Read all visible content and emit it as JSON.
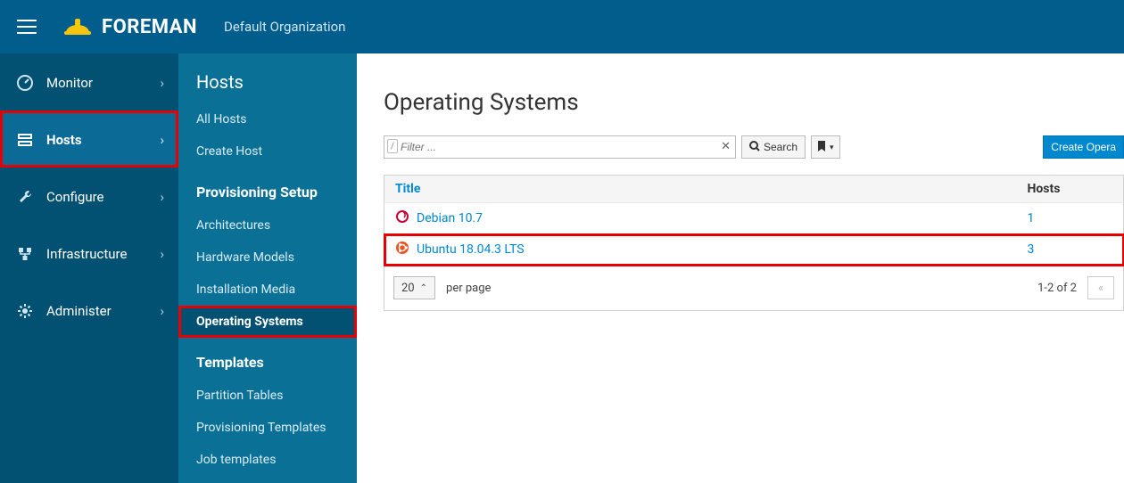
{
  "header": {
    "brand": "FOREMAN",
    "organization": "Default Organization"
  },
  "sidebar_primary": [
    {
      "icon": "dashboard-icon",
      "label": "Monitor",
      "active": false
    },
    {
      "icon": "hosts-icon",
      "label": "Hosts",
      "active": true,
      "highlight": true
    },
    {
      "icon": "wrench-icon",
      "label": "Configure",
      "active": false
    },
    {
      "icon": "infra-icon",
      "label": "Infrastructure",
      "active": false
    },
    {
      "icon": "gear-icon",
      "label": "Administer",
      "active": false
    }
  ],
  "sidebar_secondary": {
    "title": "Hosts",
    "groups": [
      {
        "heading": null,
        "items": [
          "All Hosts",
          "Create Host"
        ]
      },
      {
        "heading": "Provisioning Setup",
        "items": [
          "Architectures",
          "Hardware Models",
          "Installation Media",
          "Operating Systems"
        ]
      },
      {
        "heading": "Templates",
        "items": [
          "Partition Tables",
          "Provisioning Templates",
          "Job templates"
        ]
      }
    ],
    "selected": "Operating Systems"
  },
  "main": {
    "page_title": "Operating Systems",
    "filter_placeholder": "Filter ...",
    "search_label": "Search",
    "create_label": "Create Opera",
    "table": {
      "columns": [
        "Title",
        "Hosts"
      ],
      "rows": [
        {
          "os_icon": "debian",
          "title": "Debian 10.7",
          "hosts": "1",
          "highlight": false
        },
        {
          "os_icon": "ubuntu",
          "title": "Ubuntu 18.04.3 LTS",
          "hosts": "3",
          "highlight": true
        }
      ]
    },
    "pagination": {
      "per_page": "20",
      "per_page_label": "per page",
      "summary": "1-2 of  2"
    }
  }
}
